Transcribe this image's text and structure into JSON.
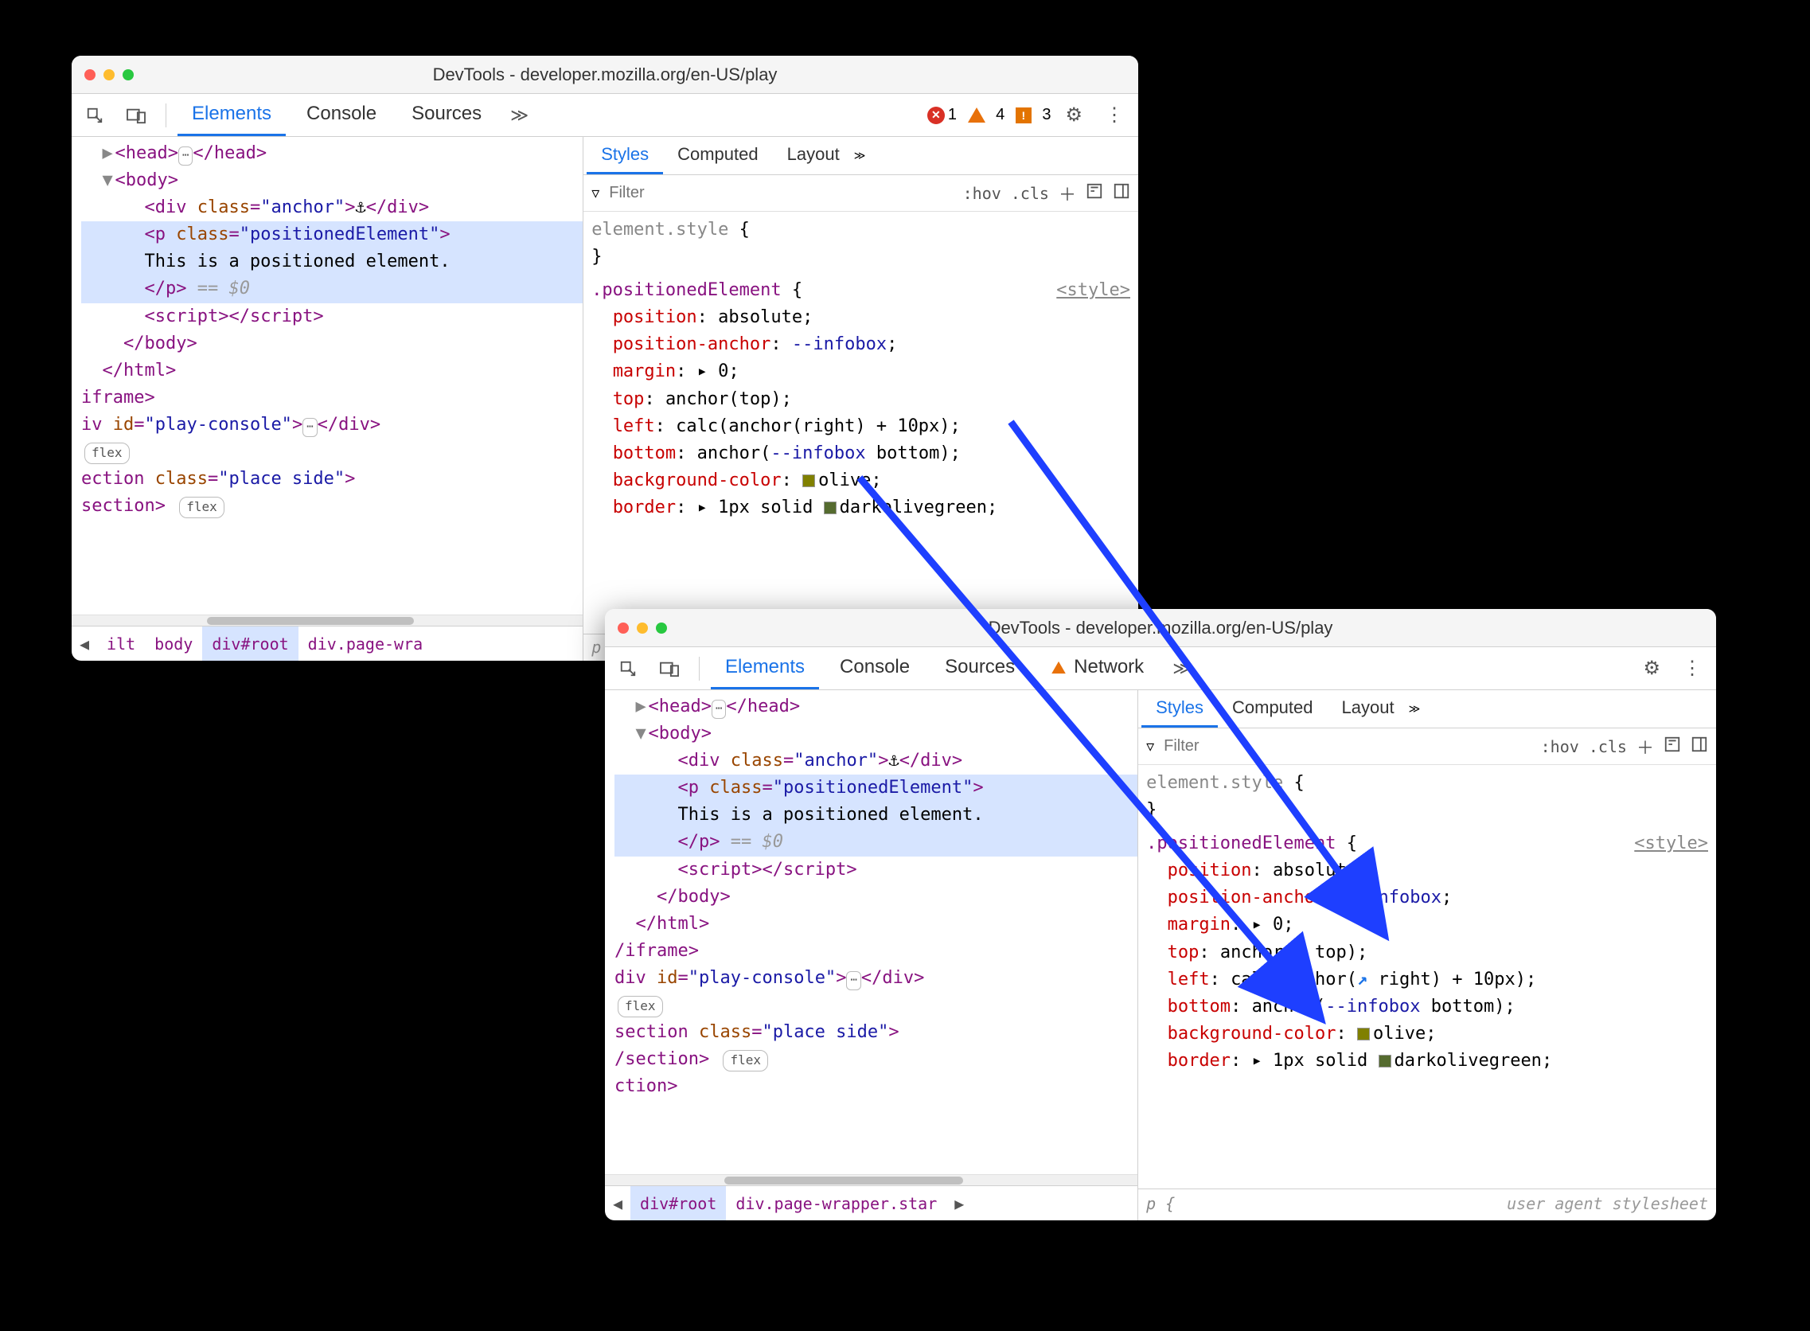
{
  "windows": {
    "w1": {
      "title": "DevTools - developer.mozilla.org/en-US/play",
      "tabs": {
        "elements": "Elements",
        "console": "Console",
        "sources": "Sources"
      },
      "counts": {
        "errors": "1",
        "warnings": "4",
        "issues": "3"
      },
      "crumbs": {
        "c0": "ilt",
        "c1": "body",
        "c2": "div#root",
        "c3": "div.page-wra"
      }
    },
    "w2": {
      "title": "DevTools - developer.mozilla.org/en-US/play",
      "tabs": {
        "elements": "Elements",
        "console": "Console",
        "sources": "Sources",
        "network": "Network"
      },
      "crumbs": {
        "c0": "div#root",
        "c1": "div.page-wrapper.star"
      }
    },
    "subtabs": {
      "styles": "Styles",
      "computed": "Computed",
      "layout": "Layout"
    },
    "filterbar": {
      "placeholder": "Filter",
      "hov": ":hov",
      "cls": ".cls"
    }
  },
  "dom": {
    "head_open": "<head>",
    "head_close": "</head>",
    "body_open": "<body>",
    "body_close": "</body>",
    "div_anchor_tag": "div",
    "div_anchor_attr_n": "class",
    "div_anchor_attr_v": "\"anchor\"",
    "anchor_glyph": "⚓",
    "div_close": "</div>",
    "p_tag": "p",
    "p_attr_n": "class",
    "p_attr_v": "\"positionedElement\"",
    "p_text": "This is a positioned element.",
    "p_close": "</p>",
    "eq_dollar": " == $0",
    "script_open": "<script>",
    "script_close": "</script>",
    "html_close": "</html>",
    "iframe_close_partial": "iframe>",
    "iframe_close_w2": "/iframe>",
    "div_play_tag_partial": "iv",
    "div_play_tag_w2": "div",
    "id_attr": "id",
    "play_val": "\"play-console\"",
    "flex": "flex",
    "section_tag_partial": "ection",
    "section_tag_w2": "section",
    "section_attr_n": "class",
    "section_attr_v": "\"place side\"",
    "section_close_partial": "section>",
    "section_close_w2": "/section>",
    "ction_partial": "ction>"
  },
  "styles": {
    "elstyle": "element.style",
    "selector": ".positionedElement",
    "srclink": "<style>",
    "rules": {
      "position_p": "position",
      "position_v": "absolute",
      "panchor_p": "position-anchor",
      "panchor_v": "--infobox",
      "margin_p": "margin",
      "margin_v": "0",
      "top_p": "top",
      "top_v1": "anchor(top)",
      "top_v2_pre": "anchor(",
      "top_v2_post": " top)",
      "left_p": "left",
      "left_v1": "calc(anchor(right) + 10px)",
      "left_v2_pre": "calc(anchor(",
      "left_v2_post": " right) + 10px)",
      "bottom_p": "bottom",
      "bottom_vpre": "anchor(",
      "bottom_id": "--infobox",
      "bottom_vpost": " bottom)",
      "bg_p": "background-color",
      "bg_v": "olive",
      "border_p": "border",
      "border_v": "1px solid ",
      "border_color": "darkolivegreen"
    },
    "p_sel": "p",
    "ua": "user agent stylesheet"
  }
}
